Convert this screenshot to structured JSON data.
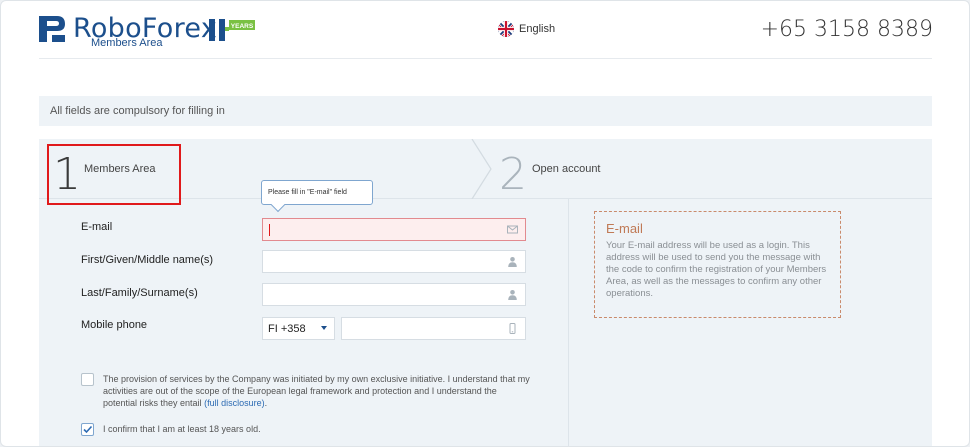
{
  "header": {
    "brand": "RoboForex",
    "brand_sub": "Members Area",
    "years_badge": "YEARS",
    "language": "English",
    "phone": "+65 3158 8389"
  },
  "notice": "All fields are compulsory for filling in",
  "steps": [
    {
      "number": "1",
      "label": "Members Area"
    },
    {
      "number": "2",
      "label": "Open account"
    }
  ],
  "form": {
    "tooltip": "Please fill in \"E-mail\" field",
    "fields": {
      "email": {
        "label": "E-mail",
        "value": ""
      },
      "first_name": {
        "label": "First/Given/Middle name(s)",
        "value": ""
      },
      "last_name": {
        "label": "Last/Family/Surname(s)",
        "value": ""
      },
      "mobile": {
        "label": "Mobile phone",
        "country_code": "FI +358",
        "value": ""
      }
    },
    "checks": [
      {
        "text": "The provision of services by the Company was initiated by my own exclusive initiative. I understand that my activities are out of the scope of the European legal framework and protection and I understand the potential risks they entail",
        "link": "(full disclosure)",
        "link_tail": ".",
        "checked": false
      },
      {
        "text": "I confirm that I am at least 18 years old.",
        "checked": true
      }
    ]
  },
  "info": {
    "title": "E-mail",
    "text": "Your E-mail address will be used as a login. This address will be used to send you the message with the code to confirm the registration of your Members Area, as well as the messages to confirm any other operations."
  },
  "colors": {
    "brand": "#1c4f8c",
    "badge_green": "#7ac143",
    "highlight_red": "#e0191b",
    "info_border": "#c98a6b"
  },
  "icons": {
    "email_field": "envelope-icon",
    "name_fields": "user-icon",
    "mobile_field": "mobile-phone-icon",
    "language": "uk-flag-icon"
  }
}
